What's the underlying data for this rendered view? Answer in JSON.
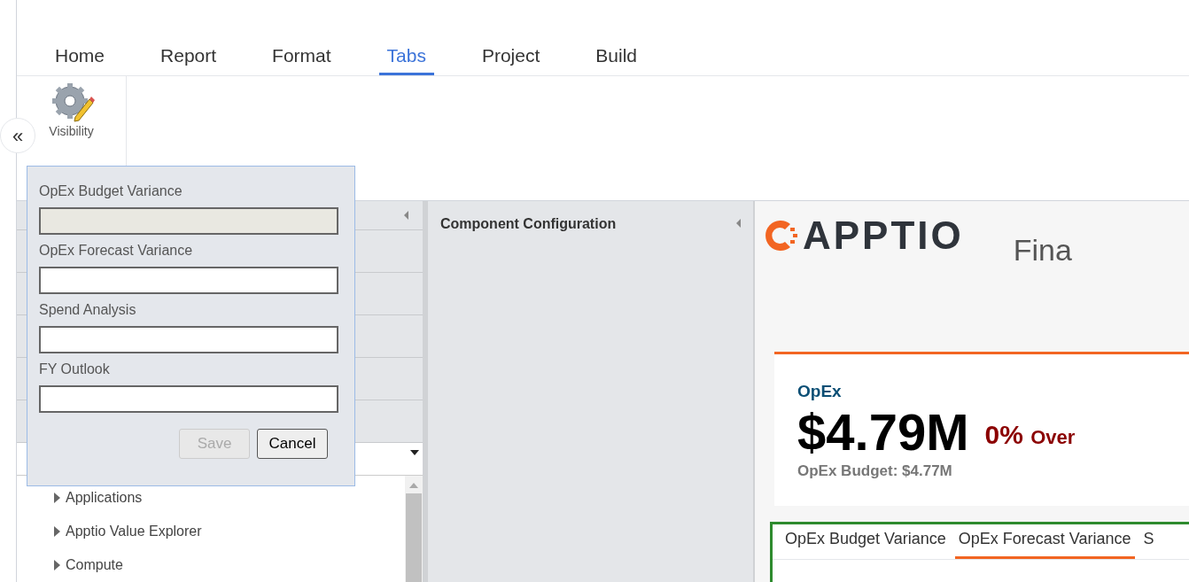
{
  "menu_tabs": [
    {
      "label": "Home",
      "selected": false
    },
    {
      "label": "Report",
      "selected": false
    },
    {
      "label": "Format",
      "selected": false
    },
    {
      "label": "Tabs",
      "selected": true
    },
    {
      "label": "Project",
      "selected": false
    },
    {
      "label": "Build",
      "selected": false
    }
  ],
  "collapse_button": "«",
  "ribbon": {
    "visibility_button": "Visibility"
  },
  "visibility_dialog": {
    "fields": [
      {
        "label": "OpEx Budget Variance",
        "disabled": true
      },
      {
        "label": "OpEx Forecast Variance",
        "disabled": false
      },
      {
        "label": "Spend Analysis",
        "disabled": false
      },
      {
        "label": "FY Outlook",
        "disabled": false
      }
    ],
    "buttons": [
      {
        "label": "Save",
        "disabled": true
      },
      {
        "label": "Cancel",
        "disabled": false
      }
    ]
  },
  "left_pane": {
    "tree": [
      {
        "label": "Applications"
      },
      {
        "label": "Apptio Value Explorer"
      },
      {
        "label": "Compute"
      }
    ]
  },
  "middle_pane": {
    "title": "Component Configuration"
  },
  "report": {
    "logo": "APPTIO",
    "title": "Fina",
    "kpi": {
      "label": "OpEx",
      "value": "$4.79M",
      "percent": "0%",
      "trend": "Over",
      "budget": "OpEx Budget: $4.77M"
    },
    "tabs": [
      {
        "label": "OpEx Budget Variance",
        "selected": false
      },
      {
        "label": "OpEx Forecast Variance",
        "selected": true
      },
      {
        "label": "S",
        "selected": false
      }
    ]
  }
}
